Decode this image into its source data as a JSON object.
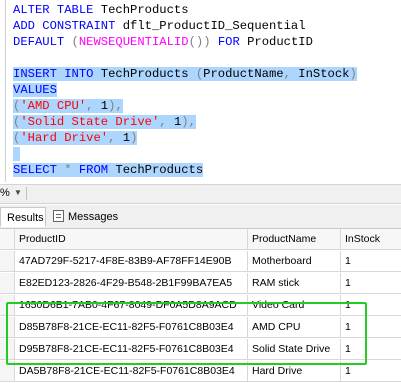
{
  "editor": {
    "lines": [
      {
        "tokens": [
          {
            "t": "ALTER TABLE ",
            "c": "kw"
          },
          {
            "t": "TechProducts",
            "c": "pl"
          }
        ]
      },
      {
        "tokens": [
          {
            "t": "ADD CONSTRAINT ",
            "c": "kw"
          },
          {
            "t": "dflt_ProductID_Sequential",
            "c": "pl"
          }
        ]
      },
      {
        "tokens": [
          {
            "t": "DEFAULT ",
            "c": "kw"
          },
          {
            "t": "(",
            "c": "gr"
          },
          {
            "t": "NEWSEQUENTIALID",
            "c": "fn"
          },
          {
            "t": "()) ",
            "c": "gr"
          },
          {
            "t": "FOR ",
            "c": "kw"
          },
          {
            "t": "ProductID",
            "c": "pl"
          }
        ]
      },
      {
        "tokens": []
      },
      {
        "tokens": [
          {
            "t": "INSERT INTO ",
            "c": "kw"
          },
          {
            "t": "TechProducts ",
            "c": "pl"
          },
          {
            "t": "(",
            "c": "gr"
          },
          {
            "t": "ProductName",
            "c": "pl"
          },
          {
            "t": ", ",
            "c": "gr"
          },
          {
            "t": "InStock",
            "c": "pl"
          },
          {
            "t": ")",
            "c": "gr"
          }
        ],
        "selected": true
      },
      {
        "tokens": [
          {
            "t": "VALUES",
            "c": "kw"
          }
        ],
        "selected": true
      },
      {
        "tokens": [
          {
            "t": "(",
            "c": "gr"
          },
          {
            "t": "'AMD CPU'",
            "c": "str"
          },
          {
            "t": ", ",
            "c": "gr"
          },
          {
            "t": "1",
            "c": "pl"
          },
          {
            "t": "),",
            "c": "gr"
          }
        ],
        "selected": true
      },
      {
        "tokens": [
          {
            "t": "(",
            "c": "gr"
          },
          {
            "t": "'Solid State Drive'",
            "c": "str"
          },
          {
            "t": ", ",
            "c": "gr"
          },
          {
            "t": "1",
            "c": "pl"
          },
          {
            "t": "),",
            "c": "gr"
          }
        ],
        "selected": true
      },
      {
        "tokens": [
          {
            "t": "(",
            "c": "gr"
          },
          {
            "t": "'Hard Drive'",
            "c": "str"
          },
          {
            "t": ", ",
            "c": "gr"
          },
          {
            "t": "1",
            "c": "pl"
          },
          {
            "t": ")",
            "c": "gr"
          }
        ],
        "selected": true
      },
      {
        "tokens": [],
        "selected": true
      },
      {
        "tokens": [
          {
            "t": "SELECT ",
            "c": "kw"
          },
          {
            "t": "* ",
            "c": "gr"
          },
          {
            "t": "FROM ",
            "c": "kw"
          },
          {
            "t": "TechProducts",
            "c": "pl"
          }
        ],
        "selected": true
      }
    ]
  },
  "zoom": {
    "label": "%",
    "arrow": "▼"
  },
  "tabs": {
    "results": "Results",
    "messages": "Messages"
  },
  "grid": {
    "columns": [
      "ProductID",
      "ProductName",
      "InStock"
    ],
    "rows": [
      [
        "47AD729F-5217-4F8E-83B9-AF78FF14E90B",
        "Motherboard",
        "1"
      ],
      [
        "E82ED123-2826-4F29-B548-2B1F99BA7EA5",
        "RAM stick",
        "1"
      ],
      [
        "1650D6B1-7AB0-4F67-8049-DF0A5D8A9ACD",
        "Video Card",
        "1"
      ],
      [
        "D85B78F8-21CE-EC11-82F5-F0761C8B03E4",
        "AMD CPU",
        "1"
      ],
      [
        "D95B78F8-21CE-EC11-82F5-F0761C8B03E4",
        "Solid State Drive",
        "1"
      ],
      [
        "DA5B78F8-21CE-EC11-82F5-F0761C8B03E4",
        "Hard Drive",
        "1"
      ]
    ]
  }
}
